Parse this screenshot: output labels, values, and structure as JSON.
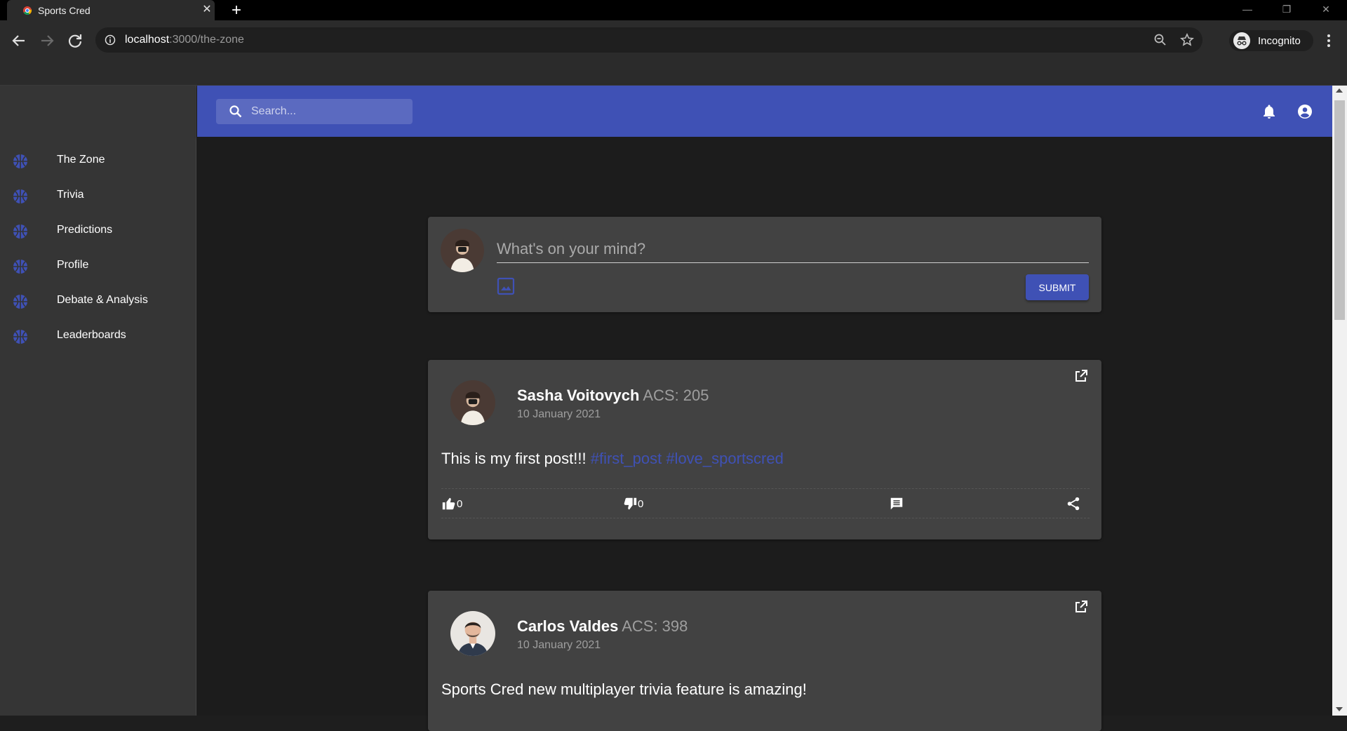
{
  "browser": {
    "tab_title": "Sports Cred",
    "url_host": "localhost",
    "url_path": ":3000/the-zone",
    "profile_label": "Incognito"
  },
  "sidebar": {
    "items": [
      {
        "label": "The Zone",
        "icon": "basketball-icon"
      },
      {
        "label": "Trivia",
        "icon": "basketball-icon"
      },
      {
        "label": "Predictions",
        "icon": "basketball-icon"
      },
      {
        "label": "Profile",
        "icon": "basketball-icon"
      },
      {
        "label": "Debate & Analysis",
        "icon": "basketball-icon"
      },
      {
        "label": "Leaderboards",
        "icon": "basketball-icon"
      }
    ]
  },
  "appbar": {
    "search_placeholder": "Search...",
    "color": "#3f51b5"
  },
  "composer": {
    "placeholder": "What's on your mind?",
    "submit_label": "SUBMIT"
  },
  "posts": [
    {
      "author": "Sasha Voitovych",
      "acs": "ACS: 205",
      "date": "10 January 2021",
      "text": "This is my first post!!!",
      "hashtags": "#first_post #love_sportscred",
      "likes": "0",
      "dislikes": "0"
    },
    {
      "author": "Carlos Valdes",
      "acs": "ACS: 398",
      "date": "10 January 2021",
      "text": "Sports Cred new multiplayer trivia feature is amazing!"
    }
  ],
  "colors": {
    "accent": "#3f51b5",
    "card": "#424242",
    "background": "#1c1c1c",
    "sidebar": "#353535"
  }
}
